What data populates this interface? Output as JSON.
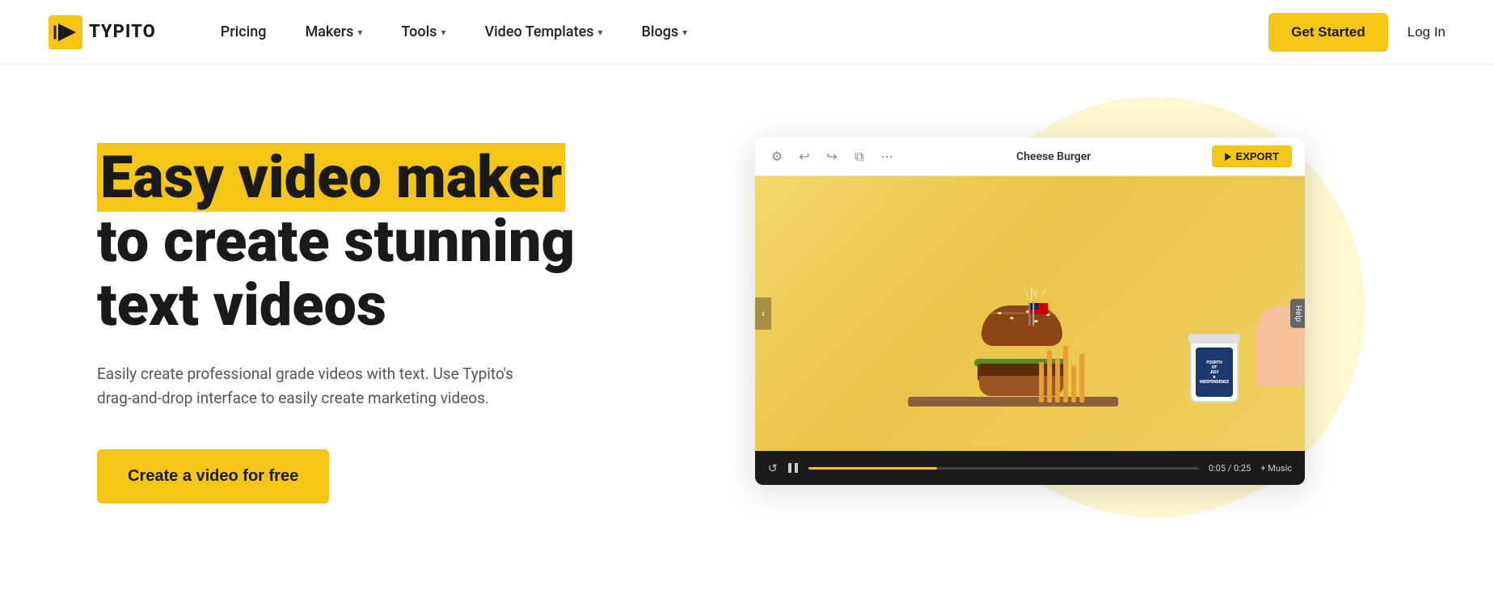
{
  "brand": {
    "logo_text": "TYPITO",
    "logo_icon": "▶"
  },
  "nav": {
    "links": [
      {
        "label": "Pricing",
        "has_dropdown": false
      },
      {
        "label": "Makers",
        "has_dropdown": true
      },
      {
        "label": "Tools",
        "has_dropdown": true
      },
      {
        "label": "Video Templates",
        "has_dropdown": true
      },
      {
        "label": "Blogs",
        "has_dropdown": true
      }
    ],
    "get_started": "Get Started",
    "login": "Log In"
  },
  "hero": {
    "title_line1": "Easy video maker",
    "title_line2": "to create stunning",
    "title_line3": "text videos",
    "highlight_word": "Easy video maker",
    "subtitle": "Easily create professional grade videos with text. Use Typito's drag-and-drop interface to easily create marketing videos.",
    "cta_label": "Create a video for free"
  },
  "editor": {
    "title": "Cheese Burger",
    "export_label": "EXPORT",
    "time_current": "0:05",
    "time_total": "0:25",
    "time_display": "0:05 / 0:25",
    "music_label": "+ Music",
    "help_label": "Help",
    "nav_arrow": "‹"
  },
  "icons": {
    "settings": "⚙",
    "undo": "↩",
    "redo": "↪",
    "copy": "⧉",
    "more": "⋯",
    "play": "▶",
    "pause": "⏸",
    "reload": "↺",
    "chevron_down": "▾"
  }
}
